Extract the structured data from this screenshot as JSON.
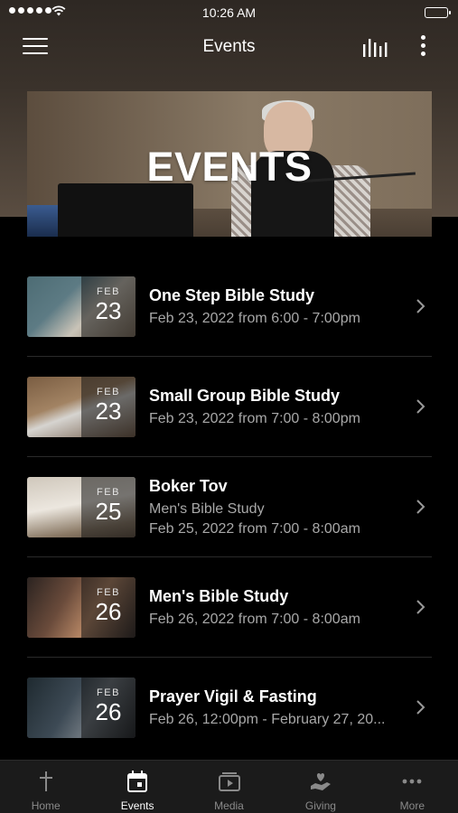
{
  "status_bar": {
    "time": "10:26 AM"
  },
  "nav": {
    "title": "Events"
  },
  "banner": {
    "title": "EVENTS"
  },
  "events": [
    {
      "month": "FEB",
      "day": "23",
      "title": "One Step Bible Study",
      "lines": [
        "Feb 23, 2022 from 6:00 - 7:00pm"
      ]
    },
    {
      "month": "FEB",
      "day": "23",
      "title": "Small Group Bible Study",
      "lines": [
        "Feb 23, 2022 from 7:00 - 8:00pm"
      ]
    },
    {
      "month": "FEB",
      "day": "25",
      "title": "Boker Tov",
      "lines": [
        "Men's Bible Study",
        "Feb 25, 2022 from 7:00 - 8:00am"
      ]
    },
    {
      "month": "FEB",
      "day": "26",
      "title": "Men's Bible Study",
      "lines": [
        "Feb 26, 2022 from 7:00 - 8:00am"
      ]
    },
    {
      "month": "FEB",
      "day": "26",
      "title": "Prayer Vigil & Fasting",
      "lines": [
        "Feb 26, 12:00pm - February 27, 20..."
      ]
    }
  ],
  "tabs": [
    {
      "label": "Home",
      "icon": "cross-icon",
      "active": false
    },
    {
      "label": "Events",
      "icon": "calendar-icon",
      "active": true
    },
    {
      "label": "Media",
      "icon": "media-icon",
      "active": false
    },
    {
      "label": "Giving",
      "icon": "giving-hand-icon",
      "active": false
    },
    {
      "label": "More",
      "icon": "more-dots-icon",
      "active": false
    }
  ],
  "colors": {
    "background": "#000000",
    "header_gradient_top": "#2e2823",
    "header_gradient_bottom": "#5a4d41",
    "tab_bar": "#1b1b1b",
    "tab_inactive": "#8a8a8a",
    "tab_active": "#ffffff",
    "subtitle_text": "#a8a8a8"
  }
}
